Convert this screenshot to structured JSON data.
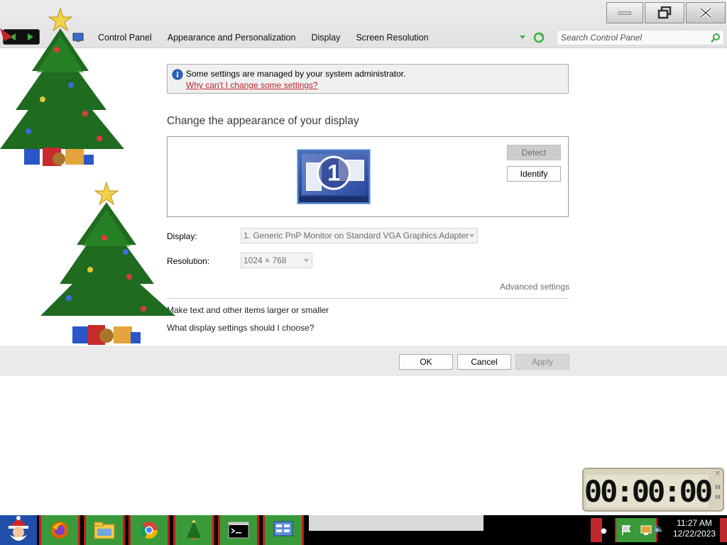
{
  "window": {
    "breadcrumbs": [
      "Control Panel",
      "Appearance and Personalization",
      "Display",
      "Screen Resolution"
    ],
    "search_placeholder": "Search Control Panel"
  },
  "admin_notice": {
    "text": "Some settings are managed by your system administrator.",
    "link": "Why can't I change some settings?"
  },
  "main": {
    "heading": "Change the appearance of your display",
    "monitor_number": "1",
    "detect_label": "Detect",
    "identify_label": "Identify",
    "display_label": "Display:",
    "display_value": "1. Generic PnP Monitor on Standard VGA Graphics Adapter",
    "resolution_label": "Resolution:",
    "resolution_value": "1024 × 768",
    "advanced_link": "Advanced settings",
    "text_size_link": "Make text and other items larger or smaller",
    "help_link": "What display settings should I choose?"
  },
  "footer": {
    "ok_label": "OK",
    "cancel_label": "Cancel",
    "apply_label": "Apply"
  },
  "gadget": {
    "timer": "00:00:00"
  },
  "taskbar": {
    "time": "11:27 AM",
    "date": "12/22/2023"
  },
  "colors": {
    "link_red": "#c0272d",
    "taskbar_green": "#3a9a3a",
    "taskbar_red": "#c41a1a"
  }
}
